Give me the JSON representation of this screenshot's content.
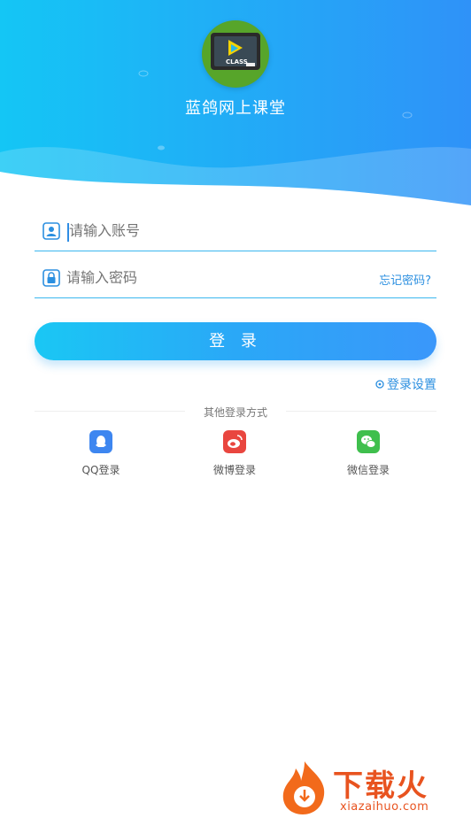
{
  "app": {
    "title": "蓝鸽网上课堂",
    "logo_text": "CLASS"
  },
  "form": {
    "account_placeholder": "请输入账号",
    "password_placeholder": "请输入密码",
    "forgot_label": "忘记密码?",
    "login_label": "登 录",
    "settings_label": "登录设置"
  },
  "other_login": {
    "title": "其他登录方式",
    "items": [
      {
        "label": "QQ登录",
        "icon": "qq-icon",
        "color": "#3d86f0"
      },
      {
        "label": "微博登录",
        "icon": "weibo-icon",
        "color": "#e9463f"
      },
      {
        "label": "微信登录",
        "icon": "wechat-icon",
        "color": "#3fbf4d"
      }
    ]
  },
  "watermark": {
    "text": "下载火",
    "url": "xiazaihuo.com"
  },
  "colors": {
    "accent": "#2b8fe0",
    "header_start": "#14c6f5",
    "header_end": "#2f92f8"
  }
}
